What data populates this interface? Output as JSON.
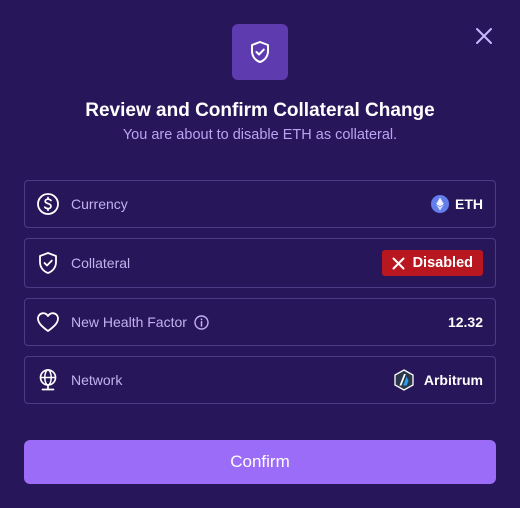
{
  "dialog": {
    "title": "Review and Confirm Collateral Change",
    "subtitle": "You are about to disable ETH as collateral.",
    "header_icon": "shield-check-icon",
    "close_icon": "close-icon"
  },
  "rows": {
    "currency": {
      "label": "Currency",
      "icon": "dollar-circle-icon",
      "value": "ETH",
      "token_icon": "ethereum-logo"
    },
    "collateral": {
      "label": "Collateral",
      "icon": "shield-check-icon",
      "badge": "Disabled",
      "badge_icon": "x-icon"
    },
    "health": {
      "label": "New Health Factor",
      "icon": "heart-icon",
      "info_icon": "info-icon",
      "value": "12.32"
    },
    "network": {
      "label": "Network",
      "icon": "globe-icon",
      "value": "Arbitrum",
      "network_icon": "arbitrum-logo"
    }
  },
  "confirm_button": {
    "label": "Confirm"
  },
  "colors": {
    "background": "#28165a",
    "accent_button": "#9a6cf8",
    "header_icon_bg": "#5f3bb0",
    "disabled_badge": "#b8171f",
    "row_border": "#4d3b86",
    "subtitle": "#b9a4f2"
  }
}
